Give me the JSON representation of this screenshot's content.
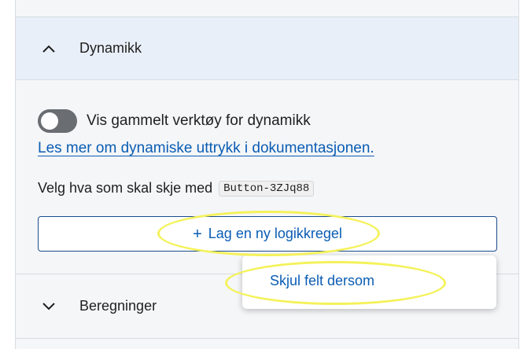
{
  "dynamics_section": {
    "title": "Dynamikk",
    "toggle": {
      "label": "Vis gammelt verktøy for dynamikk",
      "state": "off"
    },
    "doc_link": "Les mer om dynamiske uttrykk i dokumentasjonen.",
    "choose_label": "Velg hva som skal skje med",
    "component_id": "Button-3ZJq88",
    "add_rule_button": {
      "icon": "plus-icon",
      "label": "Lag en ny logikkregel"
    }
  },
  "dropdown": {
    "items": [
      "Skjul felt dersom"
    ]
  },
  "calculations_section": {
    "title": "Beregninger"
  },
  "colors": {
    "accent": "#0a5db4",
    "header_bg": "#e9eff8",
    "highlight": "#f4f25a"
  }
}
